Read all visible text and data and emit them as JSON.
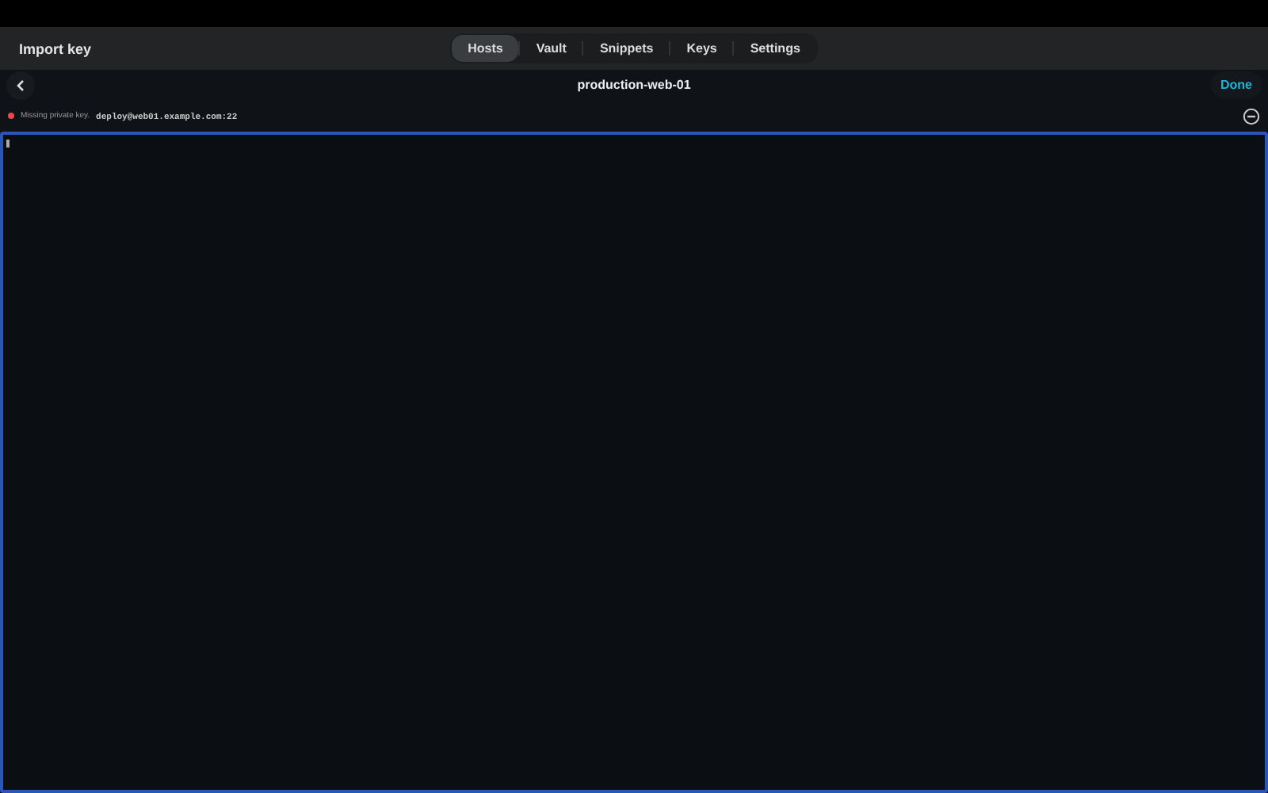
{
  "header": {
    "title": "Import key"
  },
  "tabs": [
    {
      "label": "Hosts",
      "selected": true
    },
    {
      "label": "Vault",
      "selected": false
    },
    {
      "label": "Snippets",
      "selected": false
    },
    {
      "label": "Keys",
      "selected": false
    },
    {
      "label": "Settings",
      "selected": false
    }
  ],
  "nav": {
    "title": "production-web-01",
    "done": "Done"
  },
  "status": {
    "color": "#e5484d",
    "message": "Missing private key.",
    "address": "deploy@web01.example.com:22"
  }
}
